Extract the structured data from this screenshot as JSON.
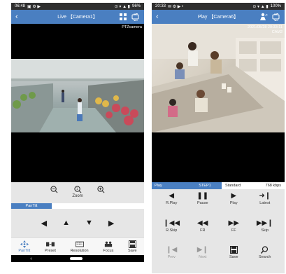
{
  "left": {
    "status": {
      "time": "06:48",
      "battery": "96%"
    },
    "header": {
      "title": "Live 【Camera1】"
    },
    "overlay": {
      "label": "PTZcamera"
    },
    "zoom": {
      "zoom_label": "Zoom"
    },
    "tab": {
      "label": "PanTilt"
    },
    "pantilt": {
      "left": "◀",
      "up": "▲",
      "down": "▼",
      "right": "▶"
    },
    "nav": [
      {
        "label": "PanTilt"
      },
      {
        "label": "Preset"
      },
      {
        "label": "Resolution"
      },
      {
        "label": "Focus"
      },
      {
        "label": "Save"
      }
    ],
    "sysnav": {
      "back": "‹"
    }
  },
  "right": {
    "status": {
      "time": "20:33",
      "battery": "100%"
    },
    "header": {
      "title": "Play 【Camera6】"
    },
    "overlay": {
      "timestamp": "2021/05/28 20:33:11",
      "cam": "CAM2"
    },
    "tabs": {
      "play": "Play",
      "step": "STEP1",
      "quality": "Standard",
      "bitrate": "768 kbps"
    },
    "controls": [
      {
        "label": "R.Play",
        "glyph": "◀",
        "enabled": true
      },
      {
        "label": "Pause",
        "glyph": "❚❚",
        "enabled": true
      },
      {
        "label": "Play",
        "glyph": "▶",
        "enabled": true
      },
      {
        "label": "Latest",
        "glyph": "➜❙",
        "enabled": true
      },
      {
        "label": "R.Skip",
        "glyph": "❙◀◀",
        "enabled": true
      },
      {
        "label": "FR",
        "glyph": "◀◀",
        "enabled": true
      },
      {
        "label": "FF",
        "glyph": "▶▶",
        "enabled": true
      },
      {
        "label": "Skip",
        "glyph": "▶▶❙",
        "enabled": true
      },
      {
        "label": "Prev",
        "glyph": "❙◀",
        "enabled": false
      },
      {
        "label": "Next",
        "glyph": "▶❙",
        "enabled": false
      },
      {
        "label": "Save",
        "glyph": "💾",
        "enabled": true
      },
      {
        "label": "Search",
        "glyph": "🔍",
        "enabled": true
      }
    ],
    "sysnav": {
      "back": "‹"
    }
  },
  "colors": {
    "accent": "#4a7fc1",
    "statusbar": "#2f2f2f"
  }
}
